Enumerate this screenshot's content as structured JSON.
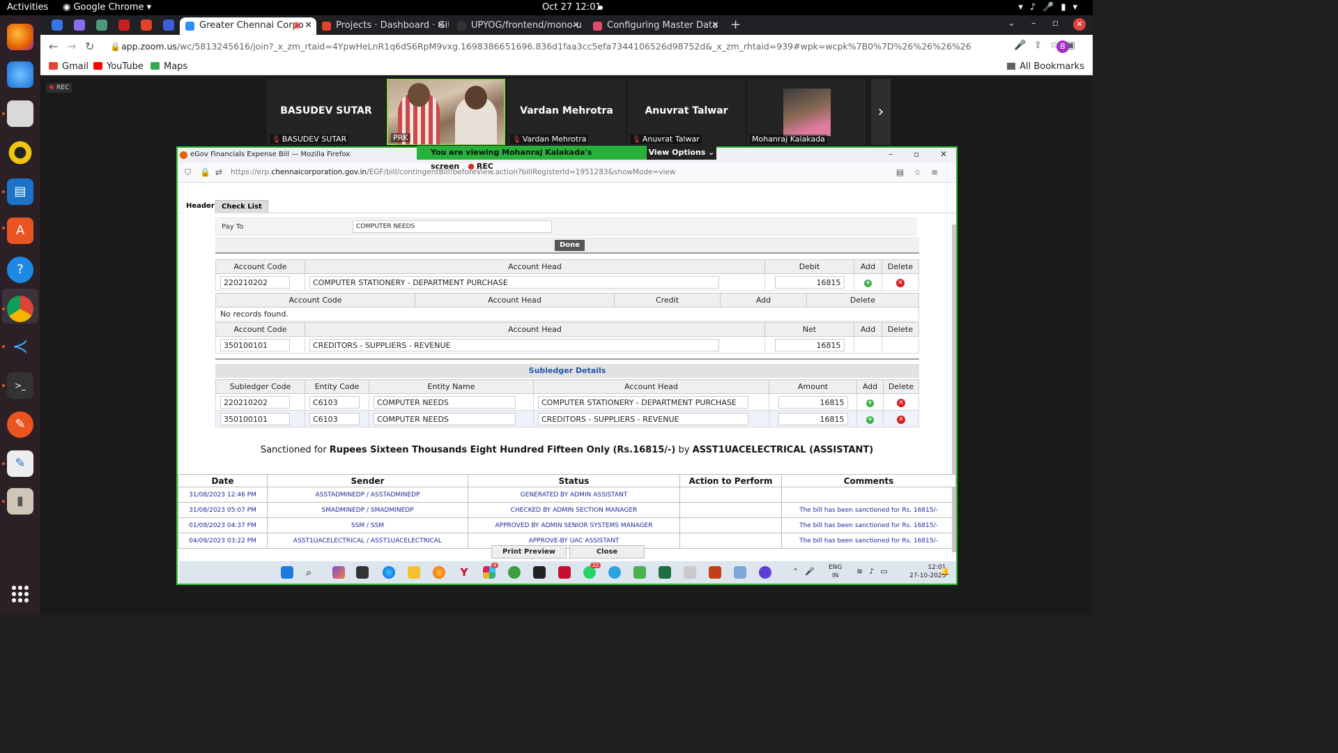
{
  "topbar": {
    "activities": "Activities",
    "app_name": "Google Chrome",
    "clock": "Oct 27  12:01"
  },
  "dock_icons": [
    "firefox-icon",
    "thunderbird-icon",
    "files-icon",
    "rhythmbox-icon",
    "writer-icon",
    "app-center-icon",
    "help-icon",
    "chrome-icon",
    "vscode-icon",
    "terminal-icon",
    "pen-icon",
    "text-editor-icon",
    "usb-icon"
  ],
  "browser": {
    "tabs": [
      {
        "label": "Greater Chennai Corpo",
        "color": "#2d8cff"
      },
      {
        "label": "Projects · Dashboard · Gitl",
        "color": "#e24329"
      },
      {
        "label": "UPYOG/frontend/mono-u",
        "color": "#333333"
      },
      {
        "label": "Configuring Master Data",
        "color": "#e34b6a"
      }
    ],
    "url_host": "app.zoom.us",
    "url_path": "/wc/5813245616/join?_x_zm_rtaid=4YpwHeLnR1q6dS6RpM9vxg.1698386651696.836d1faa3cc5efa7344106526d98752d&_x_zm_rhtaid=939#wpk=wcpk%7B0%7D%26%26%26%26wcpk5230e8cfa1ad28018a4876bd4df04...",
    "avatar_letter": "B",
    "bookmarks": [
      "Gmail",
      "YouTube",
      "Maps"
    ],
    "all_bookmarks": "All Bookmarks"
  },
  "zoom": {
    "rec": "REC",
    "participants": [
      {
        "big_name": "BASUDEV SUTAR",
        "label": "BASUDEV SUTAR",
        "muted": true
      },
      {
        "big_name": "",
        "label": "PRK",
        "muted": false,
        "video": true
      },
      {
        "big_name": "Vardan Mehrotra",
        "label": "Vardan Mehrotra",
        "muted": true
      },
      {
        "big_name": "Anuvrat Talwar",
        "label": "Anuvrat Talwar",
        "muted": true
      },
      {
        "big_name": "",
        "label": "Mohanraj Kalakada",
        "muted": false,
        "thumb": true
      }
    ],
    "viewing_banner": "You are viewing  Mohanraj Kalakada's screen",
    "viewing_rec": "REC",
    "view_options": "View Options"
  },
  "firefox": {
    "title": "eGov Financials Expense Bill — Mozilla Firefox",
    "url_prefix": "https://erp.",
    "url_domain": "chennaicorporation.gov.in",
    "url_rest": "/EGF/bill/contingentBill!beforeView.action?billRegisterId=1951283&showMode=view"
  },
  "bill": {
    "tabs": [
      "Header",
      "Check List"
    ],
    "pay_to_label": "Pay To",
    "pay_to_value": "COMPUTER NEEDS",
    "done_label": "Done",
    "debit_headers": [
      "Account Code",
      "Account Head",
      "Debit",
      "Add",
      "Delete"
    ],
    "debit_rows": [
      {
        "code": "220210202",
        "head": "COMPUTER STATIONERY - DEPARTMENT PURCHASE",
        "amount": "16815"
      }
    ],
    "credit_headers": [
      "Account Code",
      "Account Head",
      "Credit",
      "Add",
      "Delete"
    ],
    "credit_empty": "No records found.",
    "net_headers": [
      "Account Code",
      "Account Head",
      "Net",
      "Add",
      "Delete"
    ],
    "net_rows": [
      {
        "code": "350100101",
        "head": "CREDITORS - SUPPLIERS - REVENUE",
        "amount": "16815"
      }
    ],
    "subledger_title": "Subledger Details",
    "subledger_headers": [
      "Subledger Code",
      "Entity Code",
      "Entity Name",
      "Account Head",
      "Amount",
      "Add",
      "Delete"
    ],
    "subledger_rows": [
      {
        "code": "220210202",
        "entity_code": "C6103",
        "entity_name": "COMPUTER NEEDS",
        "head": "COMPUTER STATIONERY - DEPARTMENT PURCHASE",
        "amount": "16815"
      },
      {
        "code": "350100101",
        "entity_code": "C6103",
        "entity_name": "COMPUTER NEEDS",
        "head": "CREDITORS - SUPPLIERS - REVENUE",
        "amount": "16815"
      }
    ],
    "sanction_prefix": "Sanctioned for",
    "sanction_amount": "Rupees Sixteen Thousands Eight Hundred Fifteen Only (Rs.16815/-)",
    "sanction_by": "by",
    "sanction_user": "ASST1UACELECTRICAL (ASSISTANT)",
    "history_headers": [
      "Date",
      "Sender",
      "Status",
      "Action to Perform",
      "Comments"
    ],
    "history_rows": [
      {
        "date": "31/08/2023 12:46 PM",
        "sender": "ASSTADMINEDP / ASSTADMINEDP",
        "status": "GENERATED BY ADMIN ASSISTANT",
        "action": "",
        "comment": ""
      },
      {
        "date": "31/08/2023 05:07 PM",
        "sender": "SMADMINEDP / SMADMINEDP",
        "status": "CHECKED BY ADMIN SECTION MANAGER",
        "action": "",
        "comment": "The bill has been sanctioned for Rs. 16815/-"
      },
      {
        "date": "01/09/2023 04:37 PM",
        "sender": "SSM / SSM",
        "status": "APPROVED BY ADMIN SENIOR SYSTEMS MANAGER",
        "action": "",
        "comment": "The bill has been sanctioned for Rs. 16815/-"
      },
      {
        "date": "04/09/2023 03:22 PM",
        "sender": "ASST1UACELECTRICAL / ASST1UACELECTRICAL",
        "status": "APPROVE-BY UAC ASSISTANT",
        "action": "",
        "comment": "The bill has been sanctioned for Rs. 16815/-"
      }
    ],
    "print_preview": "Print Preview",
    "close": "Close"
  },
  "win_taskbar": {
    "lang": [
      "ENG",
      "IN"
    ],
    "time": "12:01",
    "date": "27-10-2023",
    "badges": [
      "4",
      "22"
    ]
  }
}
